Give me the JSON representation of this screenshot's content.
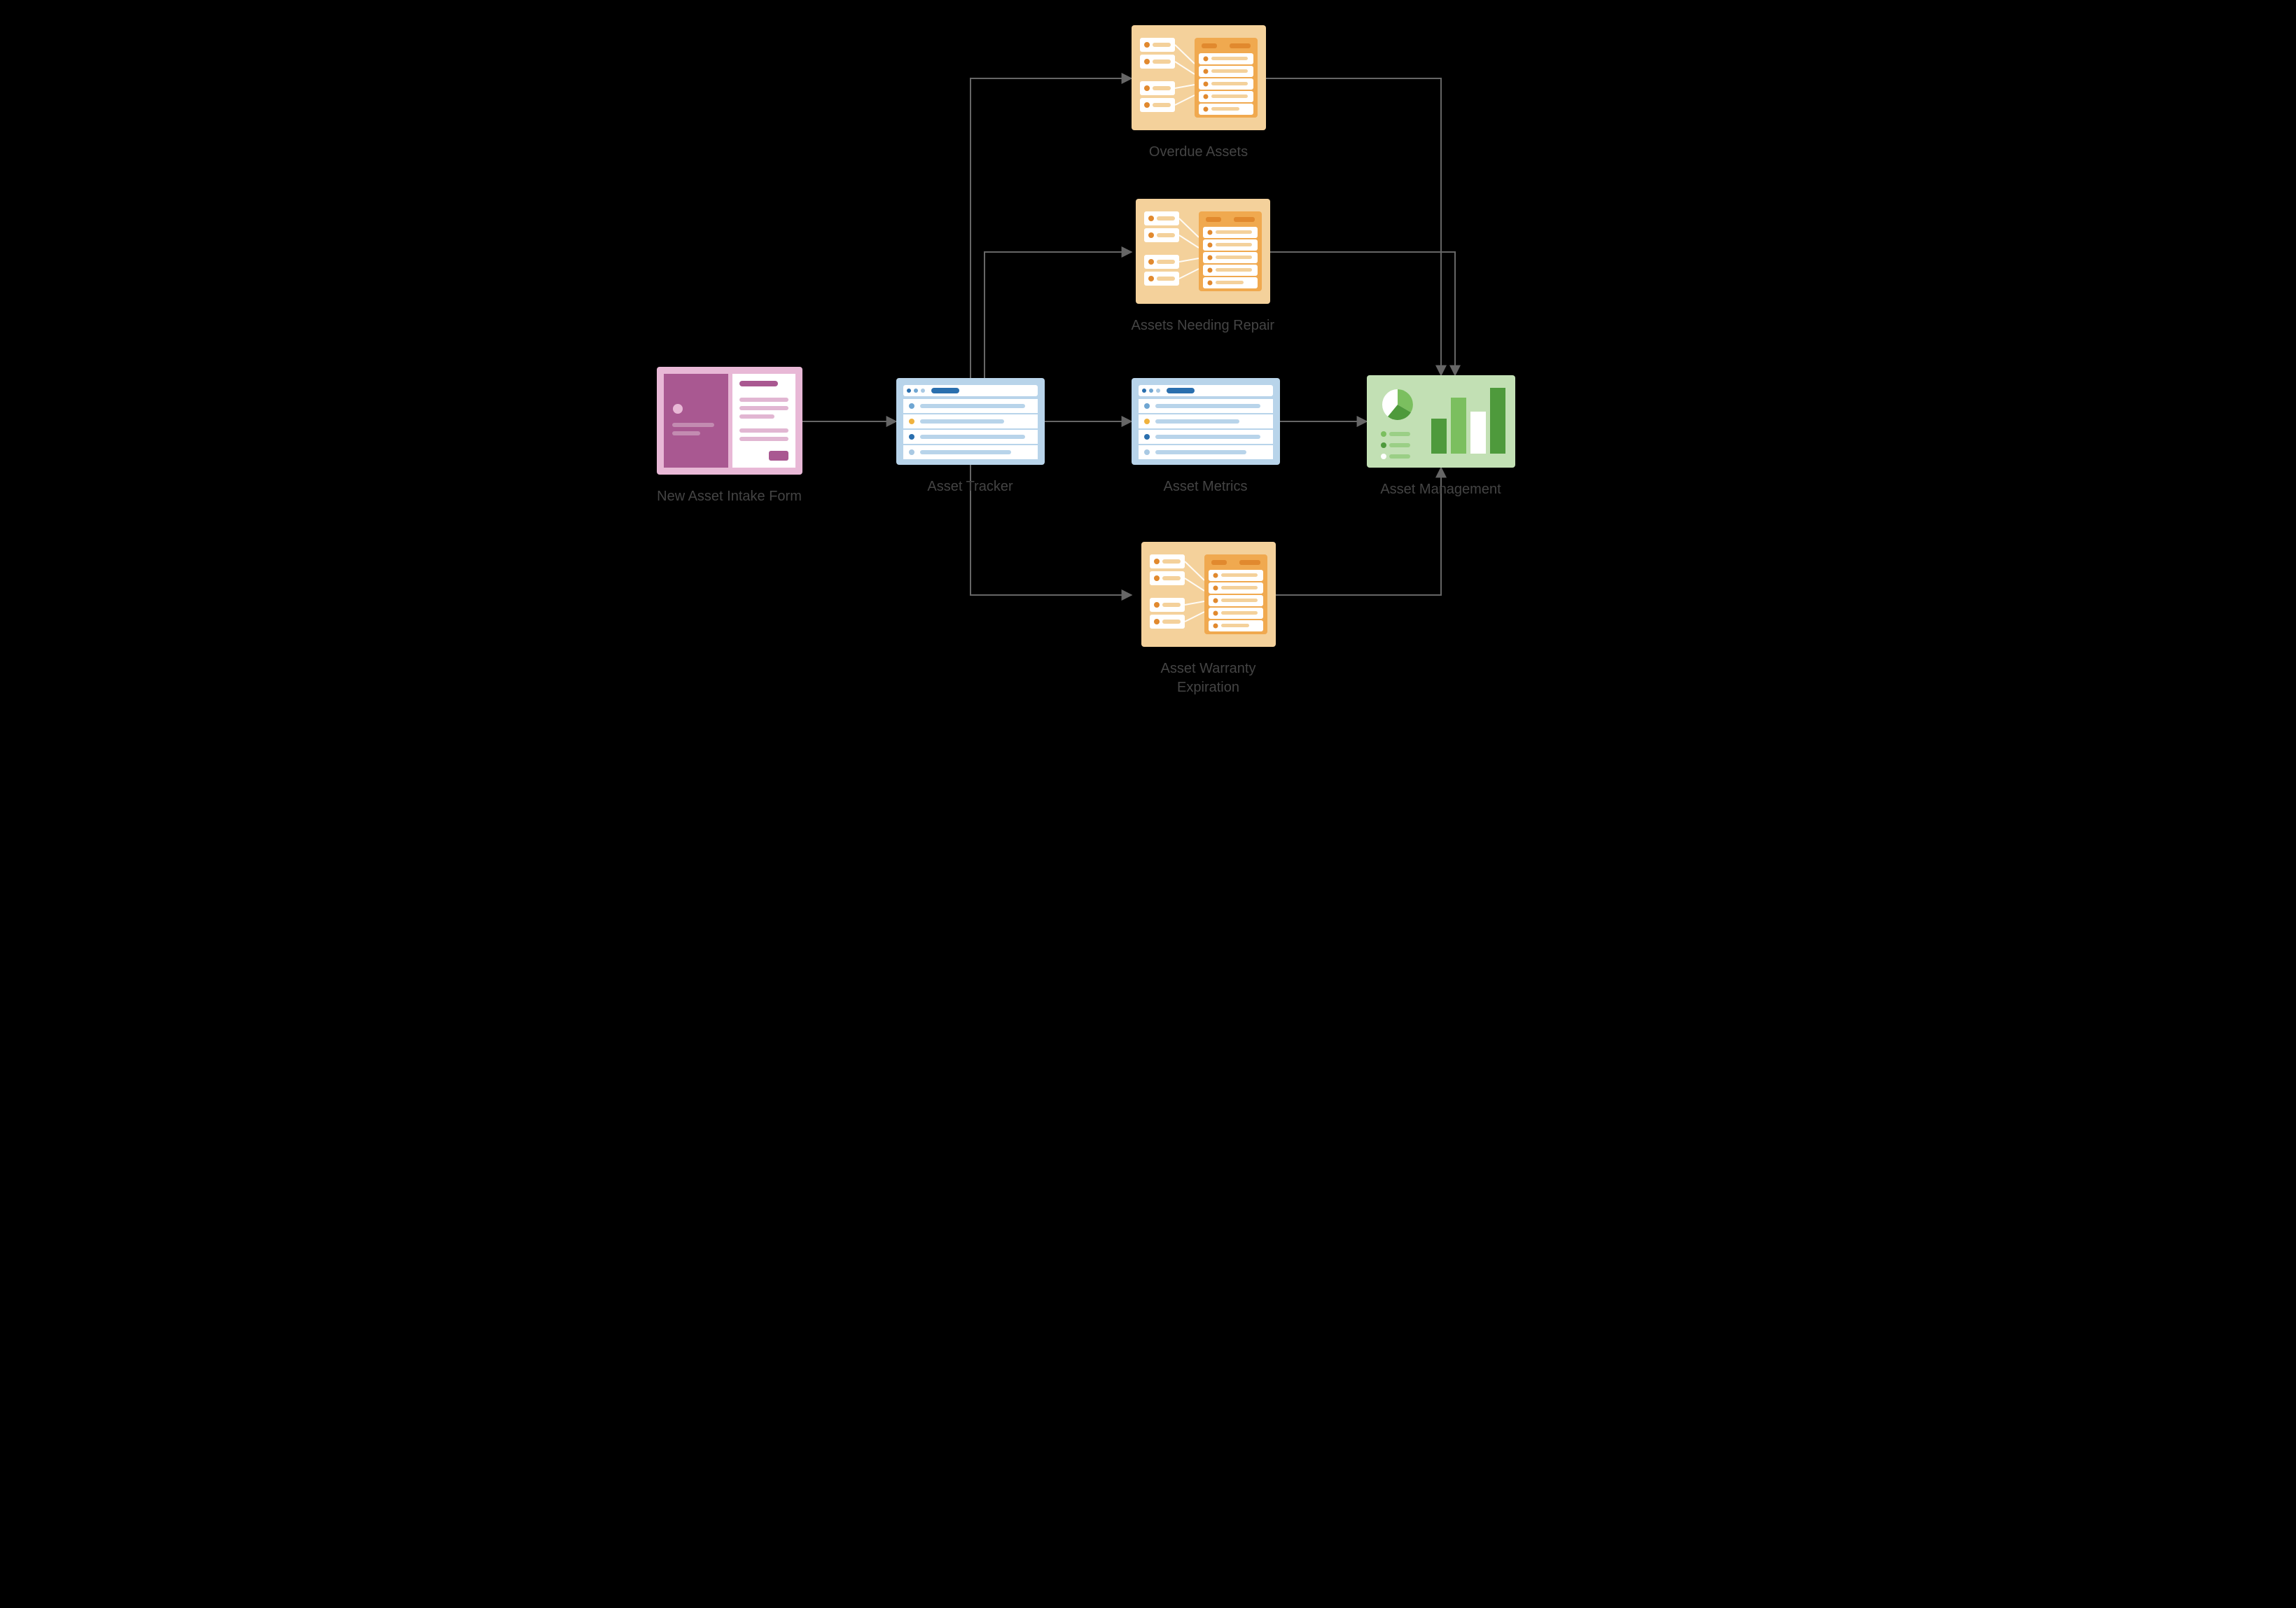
{
  "diagram": {
    "nodes": {
      "intake": {
        "label": "New Asset Intake Form"
      },
      "tracker": {
        "label": "Asset Tracker"
      },
      "metrics": {
        "label": "Asset Metrics"
      },
      "overdue": {
        "label": "Overdue Assets"
      },
      "repair": {
        "label": "Assets Needing Repair"
      },
      "warranty": {
        "label": "Asset Warranty Expiration"
      },
      "management": {
        "label": "Asset Management"
      }
    },
    "edges": [
      [
        "intake",
        "tracker"
      ],
      [
        "tracker",
        "overdue"
      ],
      [
        "tracker",
        "repair"
      ],
      [
        "tracker",
        "metrics"
      ],
      [
        "tracker",
        "warranty"
      ],
      [
        "metrics",
        "management"
      ],
      [
        "overdue",
        "management"
      ],
      [
        "repair",
        "management"
      ],
      [
        "warranty",
        "management"
      ]
    ],
    "palette": {
      "pink_bg": "#e8b8d6",
      "pink_dark": "#a95891",
      "blue_bg": "#b8d4ea",
      "blue_dark": "#2a6fae",
      "orange_bg": "#f4d19b",
      "orange_mid": "#f0a94f",
      "orange_dk": "#e1892e",
      "green_bg": "#c2e0b4",
      "green_mid": "#7bbf5f",
      "green_dk": "#4e9a3c",
      "edge": "#666666"
    }
  }
}
